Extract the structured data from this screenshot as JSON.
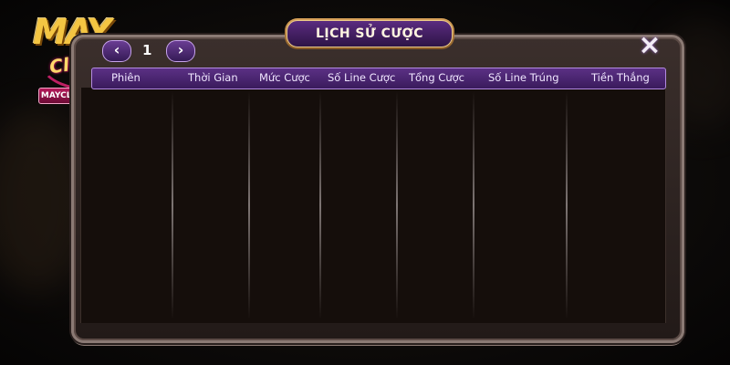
{
  "logo": {
    "main": "MAY",
    "sub": "Club",
    "domain": "MAYCLUB.DIY"
  },
  "dialog": {
    "title": "LỊCH SỬ CƯỢC",
    "close_icon": "×",
    "pagination": {
      "prev_icon": "‹",
      "next_icon": "›",
      "page": "1"
    },
    "columns": [
      "Phiên",
      "Thời Gian",
      "Mức Cược",
      "Số Line Cược",
      "Tổng Cược",
      "Số Line Trúng",
      "Tiền Thắng"
    ],
    "rows": []
  },
  "colors": {
    "accent_purple": "#5b3085",
    "gold": "#d9a35a",
    "panel": "#3b2f2c"
  },
  "icons": {
    "prev": "chevron-left-icon",
    "next": "chevron-right-icon",
    "close": "close-icon"
  }
}
